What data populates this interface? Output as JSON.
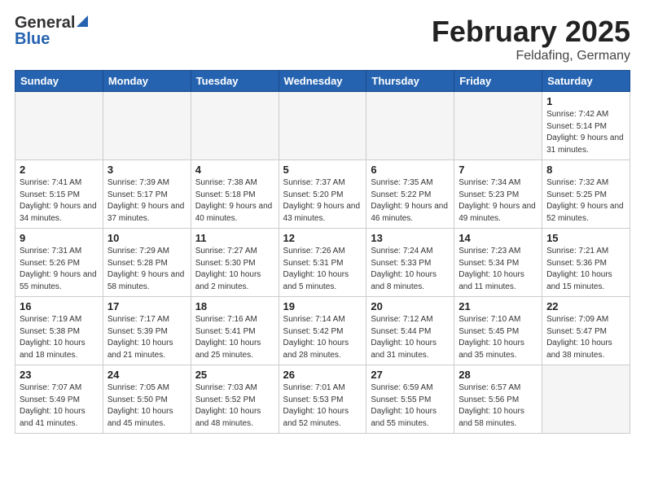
{
  "logo": {
    "general": "General",
    "blue": "Blue"
  },
  "header": {
    "month": "February 2025",
    "location": "Feldafing, Germany"
  },
  "days_of_week": [
    "Sunday",
    "Monday",
    "Tuesday",
    "Wednesday",
    "Thursday",
    "Friday",
    "Saturday"
  ],
  "weeks": [
    [
      {
        "day": "",
        "detail": "",
        "empty": true
      },
      {
        "day": "",
        "detail": "",
        "empty": true
      },
      {
        "day": "",
        "detail": "",
        "empty": true
      },
      {
        "day": "",
        "detail": "",
        "empty": true
      },
      {
        "day": "",
        "detail": "",
        "empty": true
      },
      {
        "day": "",
        "detail": "",
        "empty": true
      },
      {
        "day": "1",
        "detail": "Sunrise: 7:42 AM\nSunset: 5:14 PM\nDaylight: 9 hours and 31 minutes.",
        "empty": false
      }
    ],
    [
      {
        "day": "2",
        "detail": "Sunrise: 7:41 AM\nSunset: 5:15 PM\nDaylight: 9 hours and 34 minutes.",
        "empty": false
      },
      {
        "day": "3",
        "detail": "Sunrise: 7:39 AM\nSunset: 5:17 PM\nDaylight: 9 hours and 37 minutes.",
        "empty": false
      },
      {
        "day": "4",
        "detail": "Sunrise: 7:38 AM\nSunset: 5:18 PM\nDaylight: 9 hours and 40 minutes.",
        "empty": false
      },
      {
        "day": "5",
        "detail": "Sunrise: 7:37 AM\nSunset: 5:20 PM\nDaylight: 9 hours and 43 minutes.",
        "empty": false
      },
      {
        "day": "6",
        "detail": "Sunrise: 7:35 AM\nSunset: 5:22 PM\nDaylight: 9 hours and 46 minutes.",
        "empty": false
      },
      {
        "day": "7",
        "detail": "Sunrise: 7:34 AM\nSunset: 5:23 PM\nDaylight: 9 hours and 49 minutes.",
        "empty": false
      },
      {
        "day": "8",
        "detail": "Sunrise: 7:32 AM\nSunset: 5:25 PM\nDaylight: 9 hours and 52 minutes.",
        "empty": false
      }
    ],
    [
      {
        "day": "9",
        "detail": "Sunrise: 7:31 AM\nSunset: 5:26 PM\nDaylight: 9 hours and 55 minutes.",
        "empty": false
      },
      {
        "day": "10",
        "detail": "Sunrise: 7:29 AM\nSunset: 5:28 PM\nDaylight: 9 hours and 58 minutes.",
        "empty": false
      },
      {
        "day": "11",
        "detail": "Sunrise: 7:27 AM\nSunset: 5:30 PM\nDaylight: 10 hours and 2 minutes.",
        "empty": false
      },
      {
        "day": "12",
        "detail": "Sunrise: 7:26 AM\nSunset: 5:31 PM\nDaylight: 10 hours and 5 minutes.",
        "empty": false
      },
      {
        "day": "13",
        "detail": "Sunrise: 7:24 AM\nSunset: 5:33 PM\nDaylight: 10 hours and 8 minutes.",
        "empty": false
      },
      {
        "day": "14",
        "detail": "Sunrise: 7:23 AM\nSunset: 5:34 PM\nDaylight: 10 hours and 11 minutes.",
        "empty": false
      },
      {
        "day": "15",
        "detail": "Sunrise: 7:21 AM\nSunset: 5:36 PM\nDaylight: 10 hours and 15 minutes.",
        "empty": false
      }
    ],
    [
      {
        "day": "16",
        "detail": "Sunrise: 7:19 AM\nSunset: 5:38 PM\nDaylight: 10 hours and 18 minutes.",
        "empty": false
      },
      {
        "day": "17",
        "detail": "Sunrise: 7:17 AM\nSunset: 5:39 PM\nDaylight: 10 hours and 21 minutes.",
        "empty": false
      },
      {
        "day": "18",
        "detail": "Sunrise: 7:16 AM\nSunset: 5:41 PM\nDaylight: 10 hours and 25 minutes.",
        "empty": false
      },
      {
        "day": "19",
        "detail": "Sunrise: 7:14 AM\nSunset: 5:42 PM\nDaylight: 10 hours and 28 minutes.",
        "empty": false
      },
      {
        "day": "20",
        "detail": "Sunrise: 7:12 AM\nSunset: 5:44 PM\nDaylight: 10 hours and 31 minutes.",
        "empty": false
      },
      {
        "day": "21",
        "detail": "Sunrise: 7:10 AM\nSunset: 5:45 PM\nDaylight: 10 hours and 35 minutes.",
        "empty": false
      },
      {
        "day": "22",
        "detail": "Sunrise: 7:09 AM\nSunset: 5:47 PM\nDaylight: 10 hours and 38 minutes.",
        "empty": false
      }
    ],
    [
      {
        "day": "23",
        "detail": "Sunrise: 7:07 AM\nSunset: 5:49 PM\nDaylight: 10 hours and 41 minutes.",
        "empty": false
      },
      {
        "day": "24",
        "detail": "Sunrise: 7:05 AM\nSunset: 5:50 PM\nDaylight: 10 hours and 45 minutes.",
        "empty": false
      },
      {
        "day": "25",
        "detail": "Sunrise: 7:03 AM\nSunset: 5:52 PM\nDaylight: 10 hours and 48 minutes.",
        "empty": false
      },
      {
        "day": "26",
        "detail": "Sunrise: 7:01 AM\nSunset: 5:53 PM\nDaylight: 10 hours and 52 minutes.",
        "empty": false
      },
      {
        "day": "27",
        "detail": "Sunrise: 6:59 AM\nSunset: 5:55 PM\nDaylight: 10 hours and 55 minutes.",
        "empty": false
      },
      {
        "day": "28",
        "detail": "Sunrise: 6:57 AM\nSunset: 5:56 PM\nDaylight: 10 hours and 58 minutes.",
        "empty": false
      },
      {
        "day": "",
        "detail": "",
        "empty": true
      }
    ]
  ]
}
